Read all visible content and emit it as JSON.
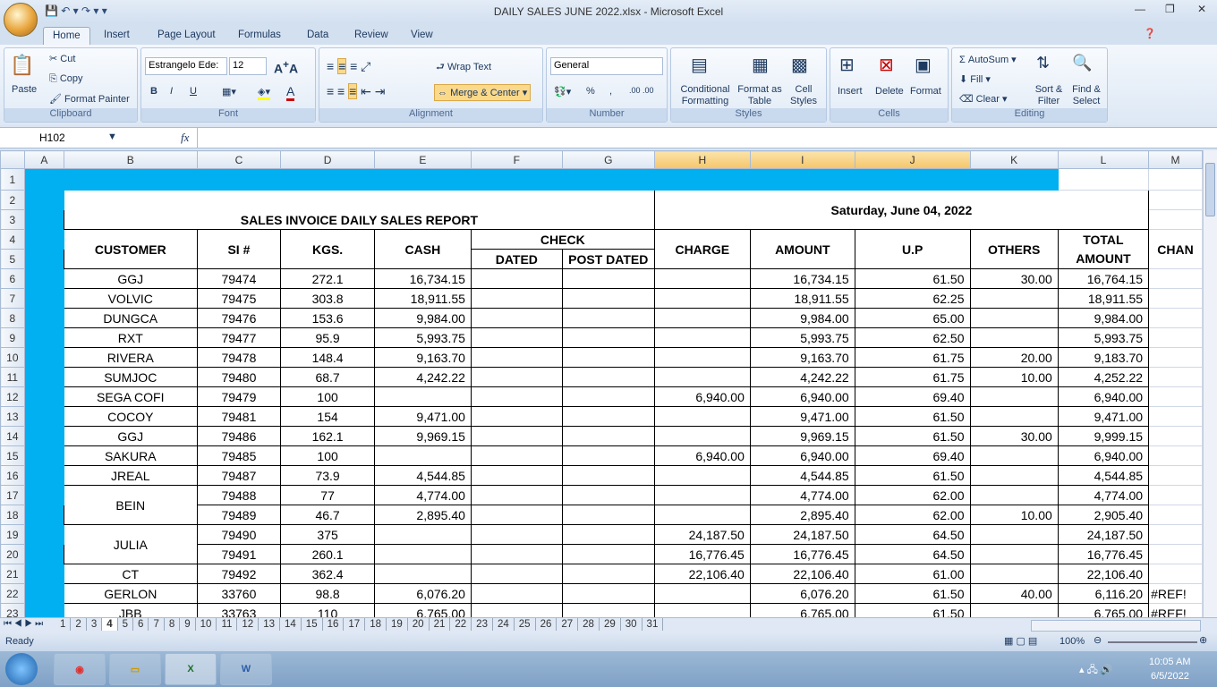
{
  "window": {
    "title": "DAILY SALES JUNE 2022.xlsx - Microsoft Excel"
  },
  "ribbon": {
    "tabs": [
      "Home",
      "Insert",
      "Page Layout",
      "Formulas",
      "Data",
      "Review",
      "View"
    ],
    "clipboard": {
      "paste": "Paste",
      "cut": "Cut",
      "copy": "Copy",
      "format_painter": "Format Painter",
      "label": "Clipboard"
    },
    "font": {
      "name": "Estrangelo Ede:",
      "size": "12",
      "label": "Font",
      "bold": "B",
      "italic": "I",
      "underline": "U"
    },
    "alignment": {
      "wrap": "Wrap Text",
      "merge": "Merge & Center",
      "label": "Alignment"
    },
    "number": {
      "format": "General",
      "percent": "%",
      "comma": ",",
      "label": "Number"
    },
    "styles": {
      "conditional": "Conditional Formatting",
      "format_table": "Format as Table",
      "cell_styles": "Cell Styles",
      "label": "Styles"
    },
    "cells": {
      "insert": "Insert",
      "delete": "Delete",
      "format": "Format",
      "label": "Cells"
    },
    "editing": {
      "autosum": "AutoSum",
      "fill": "Fill",
      "clear": "Clear",
      "sort": "Sort & Filter",
      "find": "Find & Select",
      "label": "Editing"
    }
  },
  "formula_bar": {
    "name_box": "H102",
    "fx": "fx",
    "value": ""
  },
  "columns": [
    "A",
    "B",
    "C",
    "D",
    "E",
    "F",
    "G",
    "H",
    "I",
    "J",
    "K",
    "L",
    "M"
  ],
  "report": {
    "title": "SALES INVOICE DAILY SALES REPORT",
    "date": "Saturday, June 04, 2022",
    "headers": {
      "customer": "CUSTOMER",
      "si": "SI #",
      "kgs": "KGS.",
      "cash": "CASH",
      "check": "CHECK",
      "dated": "DATED",
      "post_dated": "POST DATED",
      "charge": "CHARGE",
      "amount": "AMOUNT",
      "up": "U.P",
      "others": "OTHERS",
      "total": "TOTAL AMOUNT",
      "m": "CHAN"
    },
    "rows": [
      [
        "GGJ",
        "79474",
        "272.1",
        "16,734.15",
        "",
        "",
        "",
        "16,734.15",
        "61.50",
        "30.00",
        "16,764.15",
        ""
      ],
      [
        "VOLVIC",
        "79475",
        "303.8",
        "18,911.55",
        "",
        "",
        "",
        "18,911.55",
        "62.25",
        "",
        "18,911.55",
        ""
      ],
      [
        "DUNGCA",
        "79476",
        "153.6",
        "9,984.00",
        "",
        "",
        "",
        "9,984.00",
        "65.00",
        "",
        "9,984.00",
        ""
      ],
      [
        "RXT",
        "79477",
        "95.9",
        "5,993.75",
        "",
        "",
        "",
        "5,993.75",
        "62.50",
        "",
        "5,993.75",
        ""
      ],
      [
        "RIVERA",
        "79478",
        "148.4",
        "9,163.70",
        "",
        "",
        "",
        "9,163.70",
        "61.75",
        "20.00",
        "9,183.70",
        ""
      ],
      [
        "SUMJOC",
        "79480",
        "68.7",
        "4,242.22",
        "",
        "",
        "",
        "4,242.22",
        "61.75",
        "10.00",
        "4,252.22",
        ""
      ],
      [
        "SEGA COFI",
        "79479",
        "100",
        "",
        "",
        "",
        "6,940.00",
        "6,940.00",
        "69.40",
        "",
        "6,940.00",
        ""
      ],
      [
        "COCOY",
        "79481",
        "154",
        "9,471.00",
        "",
        "",
        "",
        "9,471.00",
        "61.50",
        "",
        "9,471.00",
        ""
      ],
      [
        "GGJ",
        "79486",
        "162.1",
        "9,969.15",
        "",
        "",
        "",
        "9,969.15",
        "61.50",
        "30.00",
        "9,999.15",
        ""
      ],
      [
        "SAKURA",
        "79485",
        "100",
        "",
        "",
        "",
        "6,940.00",
        "6,940.00",
        "69.40",
        "",
        "6,940.00",
        ""
      ],
      [
        "JREAL",
        "79487",
        "73.9",
        "4,544.85",
        "",
        "",
        "",
        "4,544.85",
        "61.50",
        "",
        "4,544.85",
        ""
      ],
      [
        "BEIN",
        "79488",
        "77",
        "4,774.00",
        "",
        "",
        "",
        "4,774.00",
        "62.00",
        "",
        "4,774.00",
        ""
      ],
      [
        "",
        "79489",
        "46.7",
        "2,895.40",
        "",
        "",
        "",
        "2,895.40",
        "62.00",
        "10.00",
        "2,905.40",
        ""
      ],
      [
        "JULIA",
        "79490",
        "375",
        "",
        "",
        "",
        "24,187.50",
        "24,187.50",
        "64.50",
        "",
        "24,187.50",
        ""
      ],
      [
        "",
        "79491",
        "260.1",
        "",
        "",
        "",
        "16,776.45",
        "16,776.45",
        "64.50",
        "",
        "16,776.45",
        ""
      ],
      [
        "CT",
        "79492",
        "362.4",
        "",
        "",
        "",
        "22,106.40",
        "22,106.40",
        "61.00",
        "",
        "22,106.40",
        ""
      ],
      [
        "GERLON",
        "33760",
        "98.8",
        "6,076.20",
        "",
        "",
        "",
        "6,076.20",
        "61.50",
        "40.00",
        "6,116.20",
        "#REF!"
      ],
      [
        "JBB",
        "33763",
        "110",
        "6,765.00",
        "",
        "",
        "",
        "6,765.00",
        "61.50",
        "",
        "6,765.00",
        "#REF!"
      ]
    ]
  },
  "sheets": [
    "1",
    "2",
    "3",
    "4",
    "5",
    "6",
    "7",
    "8",
    "9",
    "10",
    "11",
    "12",
    "13",
    "14",
    "15",
    "16",
    "17",
    "18",
    "19",
    "20",
    "21",
    "22",
    "23",
    "24",
    "25",
    "26",
    "27",
    "28",
    "29",
    "30",
    "31"
  ],
  "active_sheet": "4",
  "status": {
    "ready": "Ready",
    "zoom": "100%"
  },
  "taskbar": {
    "time": "10:05 AM",
    "date": "6/5/2022"
  },
  "colors": {
    "fill": "#00b0f0",
    "selected_header": "#f5c56b"
  }
}
